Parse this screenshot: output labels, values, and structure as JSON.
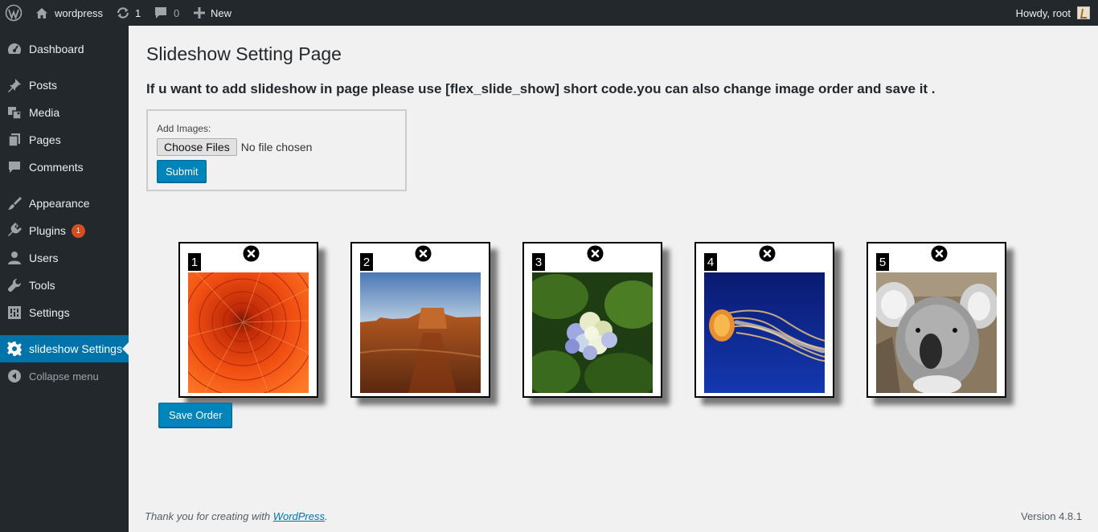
{
  "adminbar": {
    "site_name": "wordpress",
    "updates_count": "1",
    "comments_count": "0",
    "new_label": "New",
    "howdy": "Howdy, root"
  },
  "sidebar": {
    "items": [
      {
        "label": "Dashboard",
        "icon": "dashboard-icon"
      },
      {
        "label": "Posts",
        "icon": "pin-icon"
      },
      {
        "label": "Media",
        "icon": "media-icon"
      },
      {
        "label": "Pages",
        "icon": "pages-icon"
      },
      {
        "label": "Comments",
        "icon": "comment-icon"
      },
      {
        "label": "Appearance",
        "icon": "brush-icon"
      },
      {
        "label": "Plugins",
        "icon": "plugin-icon",
        "badge": "1"
      },
      {
        "label": "Users",
        "icon": "user-icon"
      },
      {
        "label": "Tools",
        "icon": "wrench-icon"
      },
      {
        "label": "Settings",
        "icon": "settings-sliders-icon"
      },
      {
        "label": "slideshow Settings",
        "icon": "gear-icon",
        "current": true
      },
      {
        "label": "Collapse menu",
        "icon": "collapse-arrow-icon"
      }
    ]
  },
  "main": {
    "title": "Slideshow Setting Page",
    "instruction": "If u want to add slideshow in page please use [flex_slide_show] short code.you can also change image order and save it .",
    "upload": {
      "label": "Add Images:",
      "choose_files": "Choose Files",
      "no_file": "No file chosen",
      "submit": "Submit"
    },
    "slides": [
      {
        "number": "1",
        "image": "orange-chrysanthemum"
      },
      {
        "number": "2",
        "image": "desert-butte"
      },
      {
        "number": "3",
        "image": "hydrangea"
      },
      {
        "number": "4",
        "image": "jellyfish"
      },
      {
        "number": "5",
        "image": "koala"
      }
    ],
    "save_order": "Save Order"
  },
  "footer": {
    "thank_you": "Thank you for creating with ",
    "wp_link": "WordPress",
    "period": ".",
    "version": "Version 4.8.1"
  },
  "colors": {
    "admin_dark": "#23282d",
    "accent_blue": "#0073aa",
    "button_blue": "#0085ba",
    "badge_orange": "#d54e21",
    "page_bg": "#f1f1f1"
  }
}
